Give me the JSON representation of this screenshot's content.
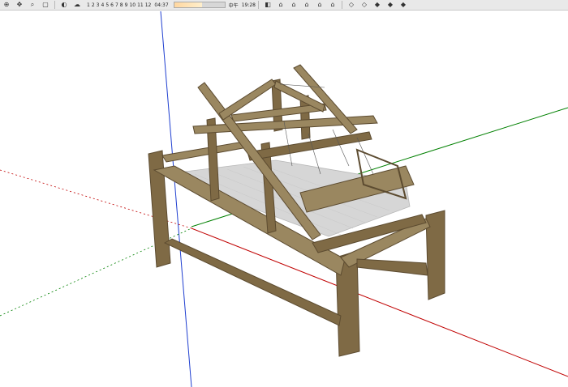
{
  "app": {
    "toolbar": {
      "months": [
        "1",
        "2",
        "3",
        "4",
        "5",
        "6",
        "7",
        "8",
        "9",
        "10",
        "11",
        "12"
      ],
      "time_left": "04:37",
      "time_mid": "中午",
      "time_right": "19:28",
      "icons": [
        "orbit-icon",
        "pan-icon",
        "zoom-icon",
        "zoom-window-icon",
        "previous-view-icon",
        "next-view-icon",
        "zoom-extents-icon",
        "x-ray-icon",
        "shadows-icon",
        "fog-icon",
        "iso-view-icon",
        "top-view-icon",
        "front-view-icon",
        "right-view-icon",
        "back-view-icon",
        "left-view-icon",
        "wireframe-icon",
        "hidden-line-icon",
        "shaded-icon",
        "shaded-textures-icon",
        "monochrome-icon",
        "section-plane-icon",
        "display-section-icon",
        "section-cut-icon",
        "warehouse-icon",
        "share-icon",
        "layers-icon"
      ]
    },
    "viewport": {
      "model_name": "Wooden loom",
      "axes": {
        "red": "#c00000",
        "green": "#008000",
        "blue": "#1f3fd0"
      },
      "colors": {
        "wood": "#7f6a45",
        "wood_dark": "#5c4b30",
        "wood_light": "#9a8760",
        "threads": "#d6d6d6"
      }
    }
  }
}
